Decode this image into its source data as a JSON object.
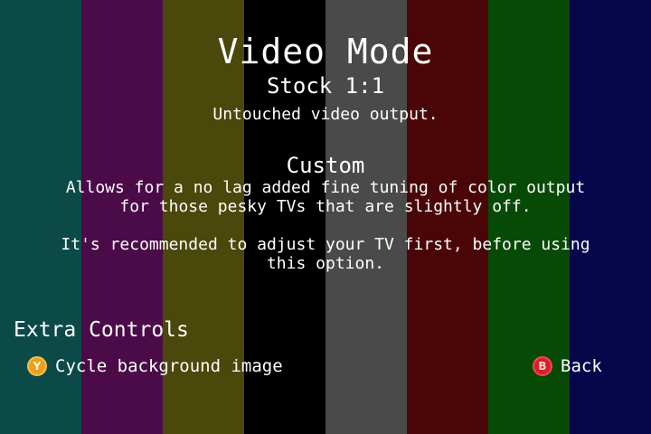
{
  "background": {
    "bar_colors": [
      "#0b4a48",
      "#4b0a48",
      "#4a480a",
      "#000000",
      "#4a4a4a",
      "#4a0606",
      "#064a06",
      "#06064a"
    ]
  },
  "title": "Video Mode",
  "modes": [
    {
      "heading": "Stock 1:1",
      "description_lines": [
        "Untouched video output."
      ]
    },
    {
      "heading": "Custom",
      "description_lines": [
        "Allows for a no lag added fine tuning of color output",
        "for those pesky TVs that are slightly off.",
        "",
        "It's recommended to adjust your TV first, before using",
        "this option."
      ]
    }
  ],
  "extra_controls": {
    "heading": "Extra Controls",
    "cycle": {
      "button_letter": "Y",
      "button_color": "#e8a020",
      "icon": "y-button-icon",
      "label": "Cycle background image"
    },
    "back": {
      "button_letter": "B",
      "button_color": "#d42027",
      "icon": "b-button-icon",
      "label": "Back"
    }
  }
}
